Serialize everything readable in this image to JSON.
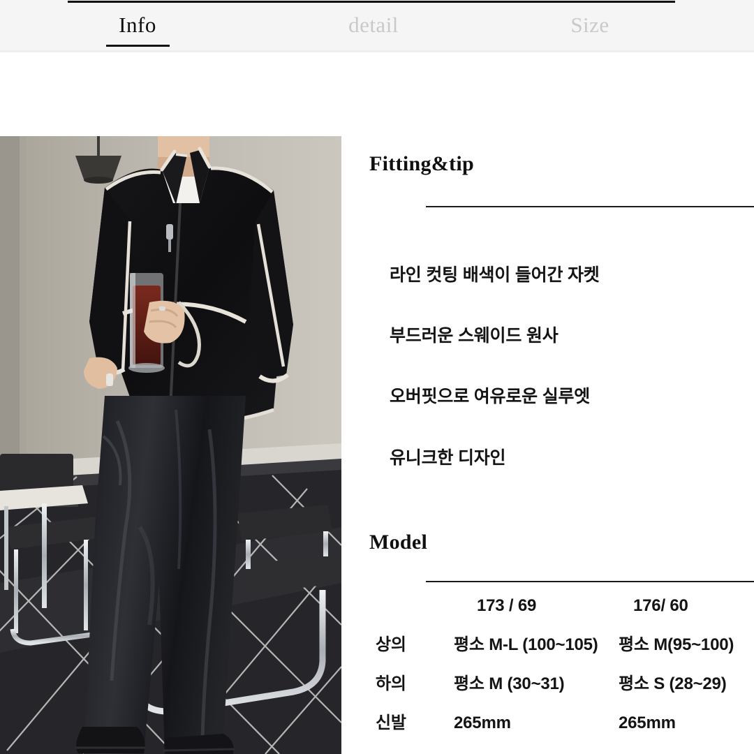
{
  "tabs": [
    {
      "label": "Info",
      "active": true
    },
    {
      "label": "detail",
      "active": false
    },
    {
      "label": "Size",
      "active": false
    }
  ],
  "photo": {
    "alt": "model-wearing-black-jacket-with-white-piping-and-black-leather-pants",
    "colors": {
      "wall": "#b5b0a7",
      "wall_light": "#c9c4bb",
      "jacket": "#151517",
      "trim": "#e8e4db",
      "skin": "#e0bda0",
      "tee": "#f2f0ec",
      "floor_tile": "#26262a",
      "grout": "#d8d8d6",
      "chrome": "#c8ccd0",
      "drink": "#5c1f18"
    }
  },
  "fitting": {
    "heading": "Fitting&tip",
    "bullets": [
      "라인 컷팅 배색이 들어간 자켓",
      "부드러운 스웨이드 원사",
      "오버핏으로 여유로운 실루엣",
      "유니크한 디자인"
    ]
  },
  "model": {
    "heading": "Model",
    "header": {
      "label": "",
      "model_a": "173 / 69",
      "model_b": "176/ 60"
    },
    "rows": [
      {
        "label": "상의",
        "model_a": "평소 M-L (100~105)",
        "model_b": "평소 M(95~100)"
      },
      {
        "label": "하의",
        "model_a": "평소 M (30~31)",
        "model_b": "평소 S (28~29)"
      },
      {
        "label": "신발",
        "model_a": "265mm",
        "model_b": "265mm"
      }
    ]
  },
  "theme": {
    "accent": "#141414",
    "header_bg": "#f5f5f6",
    "inactive_tab": "#c9c9c9",
    "text": "#141414"
  }
}
